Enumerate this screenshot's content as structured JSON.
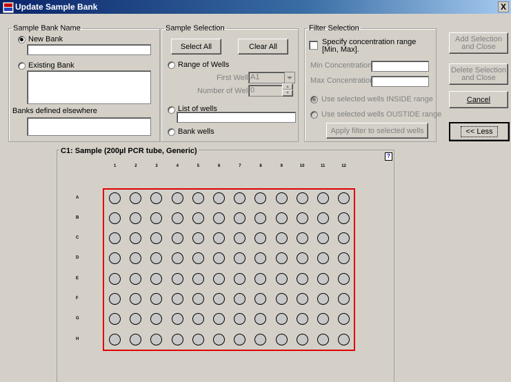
{
  "window": {
    "title": "Update Sample Bank",
    "close_label": "X"
  },
  "bank_name": {
    "legend": "Sample Bank Name",
    "new_bank_label": "New Bank",
    "new_bank_selected": true,
    "new_bank_value": "",
    "existing_bank_label": "Existing Bank",
    "banks_elsewhere_label": "Banks defined elsewhere"
  },
  "sample_selection": {
    "legend": "Sample Selection",
    "select_all": "Select All",
    "clear_all": "Clear All",
    "range_of_wells_label": "Range of Wells",
    "first_well_label": "First Well",
    "first_well_value": "A1",
    "number_of_wells_label": "Number of Wells",
    "number_of_wells_value": "0",
    "list_of_wells_label": "List of wells",
    "list_of_wells_value": "",
    "bank_wells_label": "Bank wells"
  },
  "filter_selection": {
    "legend": "Filter Selection",
    "specify_range_label_1": "Specify concentration range",
    "specify_range_label_2": "[Min, Max].",
    "min_label": "Min Concentration",
    "max_label": "Max Concentration",
    "inside_label": "Use selected wells INSIDE range",
    "outside_label": "Use selected wells OUSTIDE range",
    "apply_label": "Apply filter to selected wells"
  },
  "side_buttons": {
    "add_1": "Add Selection",
    "add_2": "and Close",
    "delete_1": "Delete Selection",
    "delete_2": "and Close",
    "cancel": "Cancel",
    "less": "<< Less"
  },
  "plate": {
    "title": "C1: Sample (200µl PCR tube, Generic)",
    "help_icon": "?",
    "columns": [
      "1",
      "2",
      "3",
      "4",
      "5",
      "6",
      "7",
      "8",
      "9",
      "10",
      "11",
      "12"
    ],
    "rows": [
      "A",
      "B",
      "C",
      "D",
      "E",
      "F",
      "G",
      "H"
    ]
  }
}
